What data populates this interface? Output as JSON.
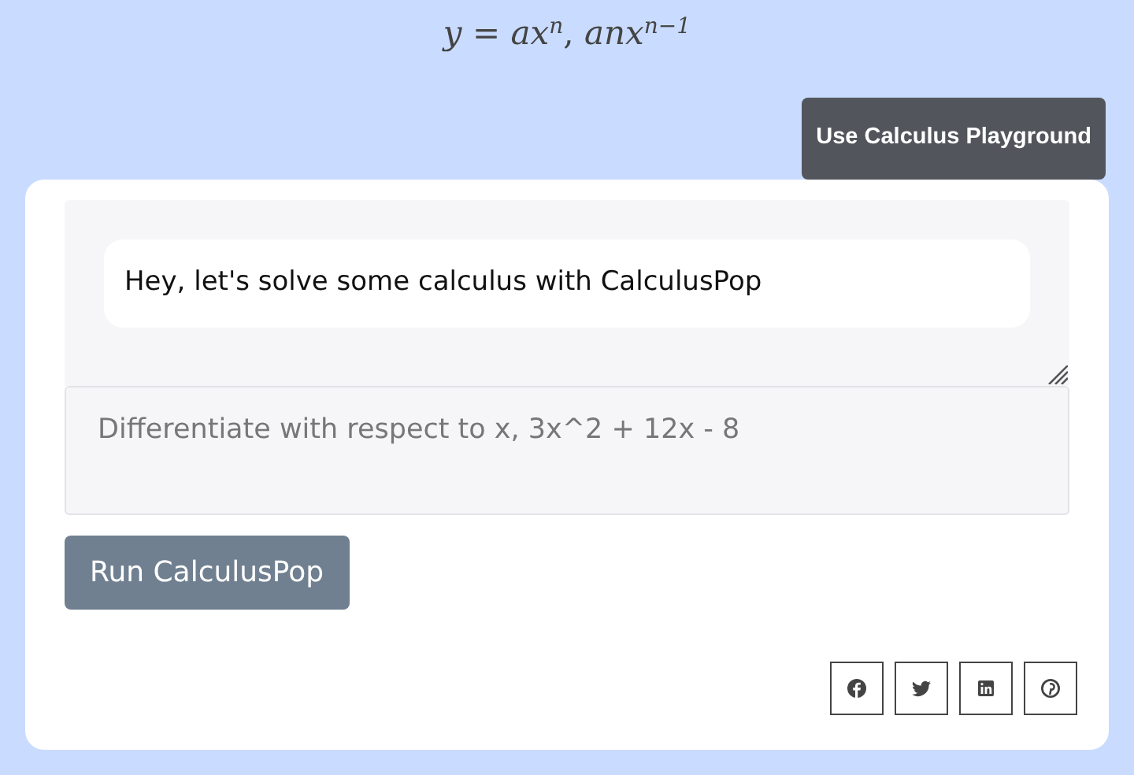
{
  "formula": "*y* = *ax*$^{n}$, *anx*$^{n−1}$",
  "playground_button": "Use Calculus Playground",
  "chat": {
    "messages": [
      {
        "text": "Hey, let's solve some calculus with CalculusPop"
      }
    ]
  },
  "prompt": {
    "placeholder": "Differentiate with respect to x, 3x^2 + 12x - 8"
  },
  "run_button": "Run CalculusPop",
  "share_buttons": [
    {
      "kind": "facebook"
    },
    {
      "kind": "twitter"
    },
    {
      "kind": "linkedin"
    },
    {
      "kind": "pinterest"
    }
  ]
}
